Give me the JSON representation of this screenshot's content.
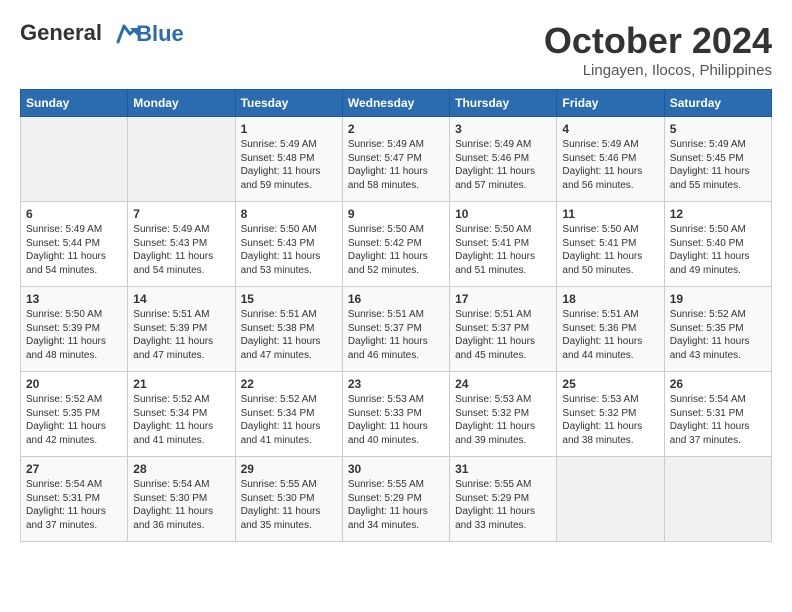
{
  "logo": {
    "text_general": "General",
    "text_blue": "Blue"
  },
  "title": "October 2024",
  "location": "Lingayen, Ilocos, Philippines",
  "weekdays": [
    "Sunday",
    "Monday",
    "Tuesday",
    "Wednesday",
    "Thursday",
    "Friday",
    "Saturday"
  ],
  "weeks": [
    [
      {
        "day": "",
        "empty": true
      },
      {
        "day": "",
        "empty": true
      },
      {
        "day": "1",
        "sunrise": "5:49 AM",
        "sunset": "5:48 PM",
        "daylight": "11 hours and 59 minutes."
      },
      {
        "day": "2",
        "sunrise": "5:49 AM",
        "sunset": "5:47 PM",
        "daylight": "11 hours and 58 minutes."
      },
      {
        "day": "3",
        "sunrise": "5:49 AM",
        "sunset": "5:46 PM",
        "daylight": "11 hours and 57 minutes."
      },
      {
        "day": "4",
        "sunrise": "5:49 AM",
        "sunset": "5:46 PM",
        "daylight": "11 hours and 56 minutes."
      },
      {
        "day": "5",
        "sunrise": "5:49 AM",
        "sunset": "5:45 PM",
        "daylight": "11 hours and 55 minutes."
      }
    ],
    [
      {
        "day": "6",
        "sunrise": "5:49 AM",
        "sunset": "5:44 PM",
        "daylight": "11 hours and 54 minutes."
      },
      {
        "day": "7",
        "sunrise": "5:49 AM",
        "sunset": "5:43 PM",
        "daylight": "11 hours and 54 minutes."
      },
      {
        "day": "8",
        "sunrise": "5:50 AM",
        "sunset": "5:43 PM",
        "daylight": "11 hours and 53 minutes."
      },
      {
        "day": "9",
        "sunrise": "5:50 AM",
        "sunset": "5:42 PM",
        "daylight": "11 hours and 52 minutes."
      },
      {
        "day": "10",
        "sunrise": "5:50 AM",
        "sunset": "5:41 PM",
        "daylight": "11 hours and 51 minutes."
      },
      {
        "day": "11",
        "sunrise": "5:50 AM",
        "sunset": "5:41 PM",
        "daylight": "11 hours and 50 minutes."
      },
      {
        "day": "12",
        "sunrise": "5:50 AM",
        "sunset": "5:40 PM",
        "daylight": "11 hours and 49 minutes."
      }
    ],
    [
      {
        "day": "13",
        "sunrise": "5:50 AM",
        "sunset": "5:39 PM",
        "daylight": "11 hours and 48 minutes."
      },
      {
        "day": "14",
        "sunrise": "5:51 AM",
        "sunset": "5:39 PM",
        "daylight": "11 hours and 47 minutes."
      },
      {
        "day": "15",
        "sunrise": "5:51 AM",
        "sunset": "5:38 PM",
        "daylight": "11 hours and 47 minutes."
      },
      {
        "day": "16",
        "sunrise": "5:51 AM",
        "sunset": "5:37 PM",
        "daylight": "11 hours and 46 minutes."
      },
      {
        "day": "17",
        "sunrise": "5:51 AM",
        "sunset": "5:37 PM",
        "daylight": "11 hours and 45 minutes."
      },
      {
        "day": "18",
        "sunrise": "5:51 AM",
        "sunset": "5:36 PM",
        "daylight": "11 hours and 44 minutes."
      },
      {
        "day": "19",
        "sunrise": "5:52 AM",
        "sunset": "5:35 PM",
        "daylight": "11 hours and 43 minutes."
      }
    ],
    [
      {
        "day": "20",
        "sunrise": "5:52 AM",
        "sunset": "5:35 PM",
        "daylight": "11 hours and 42 minutes."
      },
      {
        "day": "21",
        "sunrise": "5:52 AM",
        "sunset": "5:34 PM",
        "daylight": "11 hours and 41 minutes."
      },
      {
        "day": "22",
        "sunrise": "5:52 AM",
        "sunset": "5:34 PM",
        "daylight": "11 hours and 41 minutes."
      },
      {
        "day": "23",
        "sunrise": "5:53 AM",
        "sunset": "5:33 PM",
        "daylight": "11 hours and 40 minutes."
      },
      {
        "day": "24",
        "sunrise": "5:53 AM",
        "sunset": "5:32 PM",
        "daylight": "11 hours and 39 minutes."
      },
      {
        "day": "25",
        "sunrise": "5:53 AM",
        "sunset": "5:32 PM",
        "daylight": "11 hours and 38 minutes."
      },
      {
        "day": "26",
        "sunrise": "5:54 AM",
        "sunset": "5:31 PM",
        "daylight": "11 hours and 37 minutes."
      }
    ],
    [
      {
        "day": "27",
        "sunrise": "5:54 AM",
        "sunset": "5:31 PM",
        "daylight": "11 hours and 37 minutes."
      },
      {
        "day": "28",
        "sunrise": "5:54 AM",
        "sunset": "5:30 PM",
        "daylight": "11 hours and 36 minutes."
      },
      {
        "day": "29",
        "sunrise": "5:55 AM",
        "sunset": "5:30 PM",
        "daylight": "11 hours and 35 minutes."
      },
      {
        "day": "30",
        "sunrise": "5:55 AM",
        "sunset": "5:29 PM",
        "daylight": "11 hours and 34 minutes."
      },
      {
        "day": "31",
        "sunrise": "5:55 AM",
        "sunset": "5:29 PM",
        "daylight": "11 hours and 33 minutes."
      },
      {
        "day": "",
        "empty": true
      },
      {
        "day": "",
        "empty": true
      }
    ]
  ],
  "labels": {
    "sunrise": "Sunrise:",
    "sunset": "Sunset:",
    "daylight": "Daylight:"
  }
}
